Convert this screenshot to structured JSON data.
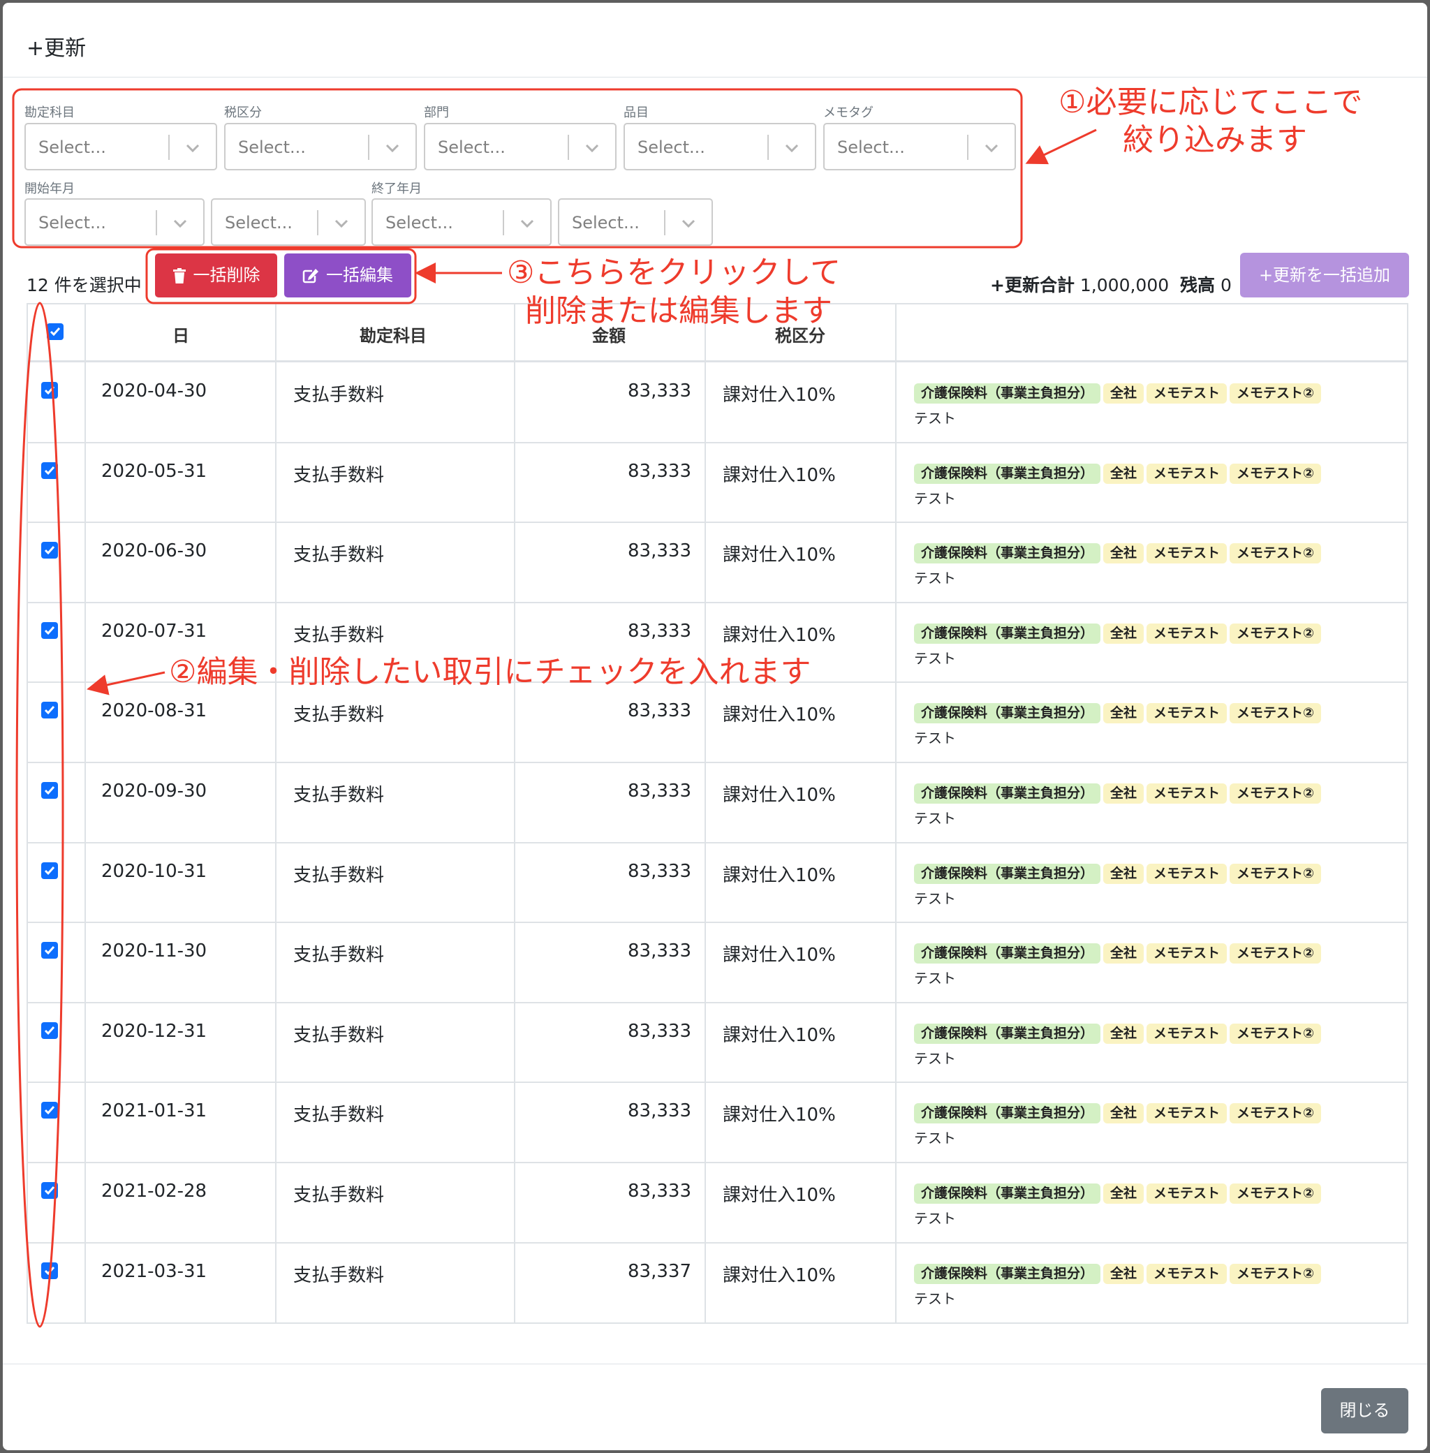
{
  "modal": {
    "title": "+更新",
    "close_label": "閉じる"
  },
  "filters": {
    "row1": [
      {
        "label": "勘定科目",
        "placeholder": "Select..."
      },
      {
        "label": "税区分",
        "placeholder": "Select..."
      },
      {
        "label": "部門",
        "placeholder": "Select..."
      },
      {
        "label": "品目",
        "placeholder": "Select..."
      },
      {
        "label": "メモタグ",
        "placeholder": "Select..."
      }
    ],
    "start_label": "開始年月",
    "end_label": "終了年月",
    "row2_placeholders": [
      "Select...",
      "Select...",
      "Select...",
      "Select..."
    ]
  },
  "toolbar": {
    "selected_text": "12 件を選択中",
    "bulk_delete": "一括削除",
    "bulk_edit": "一括編集",
    "total_label": "+更新合計",
    "total_value": "1,000,000",
    "balance_label": "残高",
    "balance_value": "0",
    "bulk_add": "+更新を一括追加"
  },
  "table": {
    "headers": {
      "date": "日",
      "account": "勘定科目",
      "amount": "金額",
      "tax": "税区分"
    },
    "header_checked": true,
    "rows": [
      {
        "date": "2020-04-30",
        "account": "支払手数料",
        "amount": "83,333",
        "tax": "課対仕入10%",
        "checked": true
      },
      {
        "date": "2020-05-31",
        "account": "支払手数料",
        "amount": "83,333",
        "tax": "課対仕入10%",
        "checked": true
      },
      {
        "date": "2020-06-30",
        "account": "支払手数料",
        "amount": "83,333",
        "tax": "課対仕入10%",
        "checked": true
      },
      {
        "date": "2020-07-31",
        "account": "支払手数料",
        "amount": "83,333",
        "tax": "課対仕入10%",
        "checked": true
      },
      {
        "date": "2020-08-31",
        "account": "支払手数料",
        "amount": "83,333",
        "tax": "課対仕入10%",
        "checked": true
      },
      {
        "date": "2020-09-30",
        "account": "支払手数料",
        "amount": "83,333",
        "tax": "課対仕入10%",
        "checked": true
      },
      {
        "date": "2020-10-31",
        "account": "支払手数料",
        "amount": "83,333",
        "tax": "課対仕入10%",
        "checked": true
      },
      {
        "date": "2020-11-30",
        "account": "支払手数料",
        "amount": "83,333",
        "tax": "課対仕入10%",
        "checked": true
      },
      {
        "date": "2020-12-31",
        "account": "支払手数料",
        "amount": "83,333",
        "tax": "課対仕入10%",
        "checked": true
      },
      {
        "date": "2021-01-31",
        "account": "支払手数料",
        "amount": "83,333",
        "tax": "課対仕入10%",
        "checked": true
      },
      {
        "date": "2021-02-28",
        "account": "支払手数料",
        "amount": "83,333",
        "tax": "課対仕入10%",
        "checked": true
      },
      {
        "date": "2021-03-31",
        "account": "支払手数料",
        "amount": "83,337",
        "tax": "課対仕入10%",
        "checked": true
      }
    ],
    "tags": [
      {
        "text": "介護保険料（事業主負担分）",
        "color": "#d4f0c4"
      },
      {
        "text": "全社",
        "color": "#faf3c2"
      },
      {
        "text": "メモテスト",
        "color": "#faf3c2"
      },
      {
        "text": "メモテスト②",
        "color": "#faf3c2"
      }
    ],
    "memo": "テスト"
  },
  "annotations": {
    "filter_note": [
      "①必要に応じてここで",
      "絞り込みます"
    ],
    "bulk_note": [
      "③こちらをクリックして",
      "削除または編集します"
    ],
    "check_note": "②編集・削除したい取引にチェックを入れます",
    "color": "#ee3b2c"
  },
  "colors": {
    "danger": "#dc3545",
    "purple": "#8e4fc7",
    "purple_light": "#b593de",
    "checkbox": "#0d6efd",
    "secondary": "#6c757d"
  }
}
